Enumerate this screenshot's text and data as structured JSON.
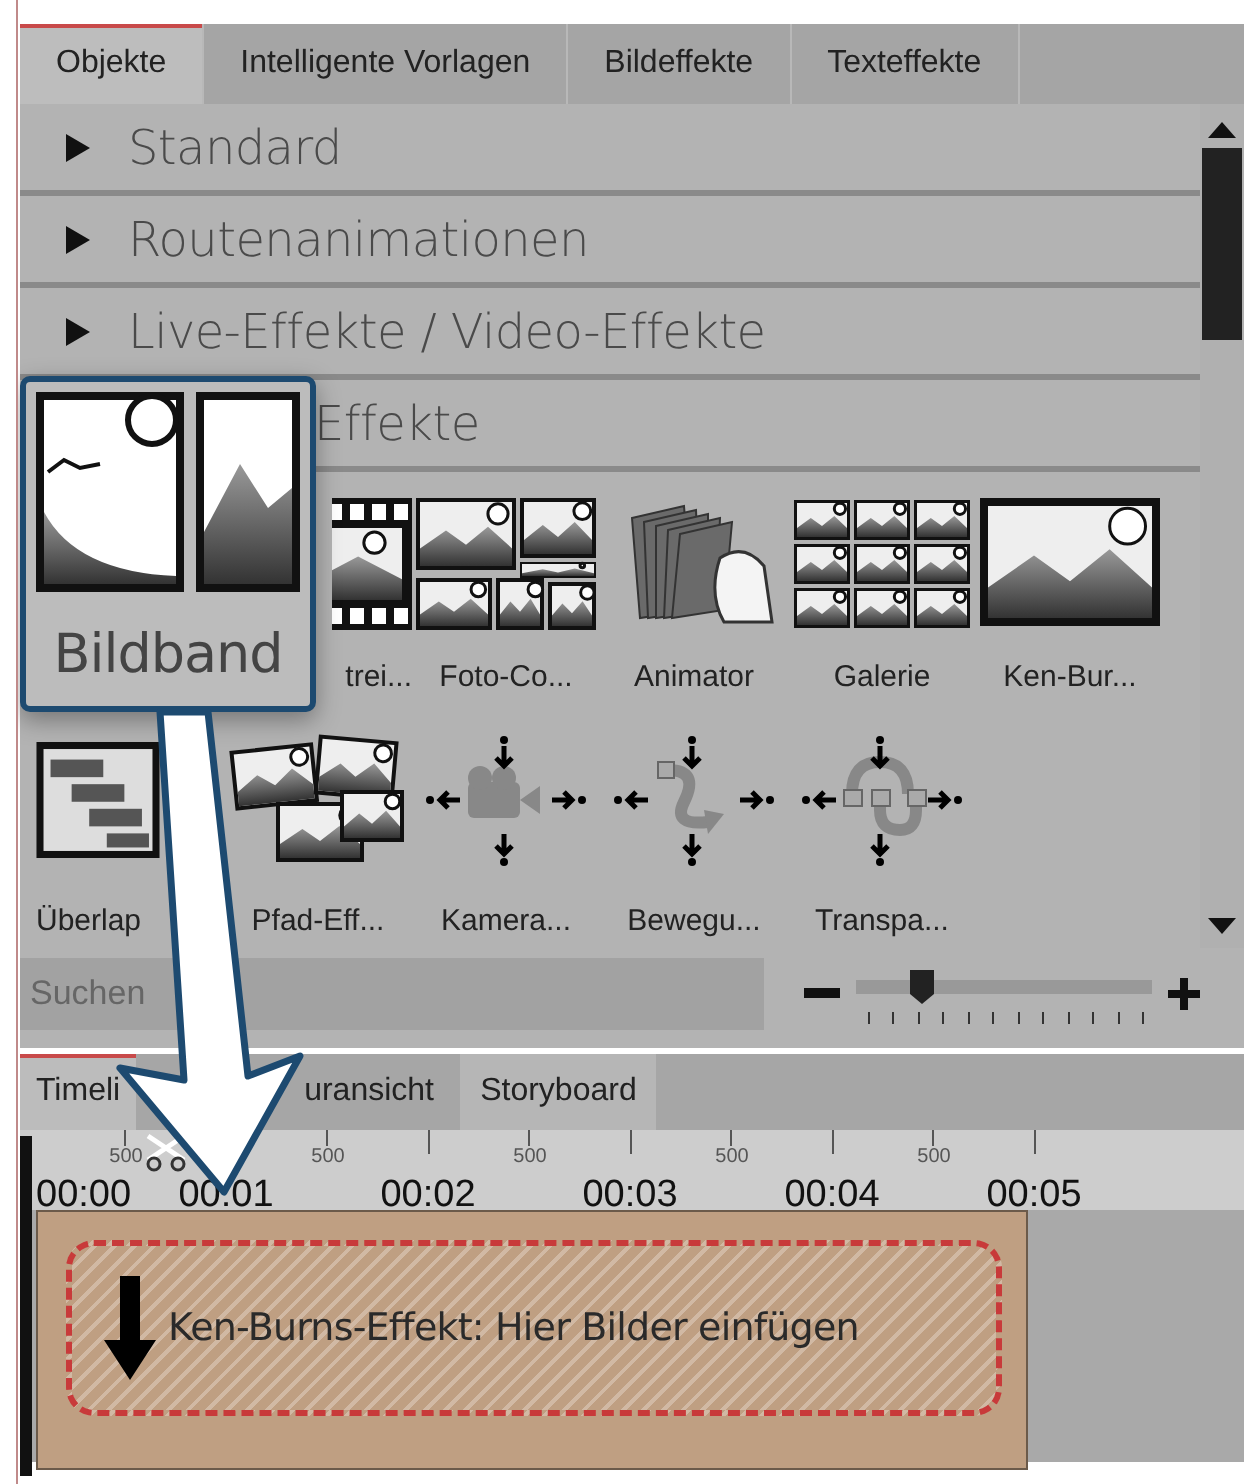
{
  "top_tabs": [
    {
      "label": "Objekte",
      "selected": true
    },
    {
      "label": "Intelligente Vorlagen",
      "selected": false
    },
    {
      "label": "Bildeffekte",
      "selected": false
    },
    {
      "label": "Texteffekte",
      "selected": false
    }
  ],
  "categories": [
    {
      "kind": "category",
      "label": "Standard",
      "expanded": false
    },
    {
      "kind": "category",
      "label": "Routenanimationen",
      "expanded": false
    },
    {
      "kind": "category",
      "label": "Live-Effekte / Video-Effekte",
      "expanded": false
    },
    {
      "kind": "partial",
      "label": "Effekte"
    }
  ],
  "effects": [
    {
      "label": "trei..."
    },
    {
      "label": "Foto-Co..."
    },
    {
      "label": "Animator"
    },
    {
      "label": "Galerie"
    },
    {
      "label": "Ken-Bur..."
    },
    {
      "label": "Überlap"
    },
    {
      "label": "Pfad-Eff..."
    },
    {
      "label": "Kamera..."
    },
    {
      "label": "Bewegu..."
    },
    {
      "label": "Transpa..."
    }
  ],
  "search": {
    "placeholder": "Suchen"
  },
  "zoom": {
    "level": 0.22
  },
  "bottom_tabs": [
    {
      "label": "Timeli",
      "selected": true
    },
    {
      "label": "uransicht",
      "selected": false
    },
    {
      "label": "Storyboard",
      "selected": false
    }
  ],
  "ruler": {
    "minor_labels": [
      "500",
      "500",
      "500",
      "500",
      "500"
    ],
    "times": [
      "00:00",
      "00:01",
      "00:02",
      "00:03",
      "00:04",
      "00:05"
    ]
  },
  "clip": {
    "text": "Ken-Burns-Effekt: Hier Bilder einfügen"
  },
  "callout": {
    "label": "Bildband"
  }
}
